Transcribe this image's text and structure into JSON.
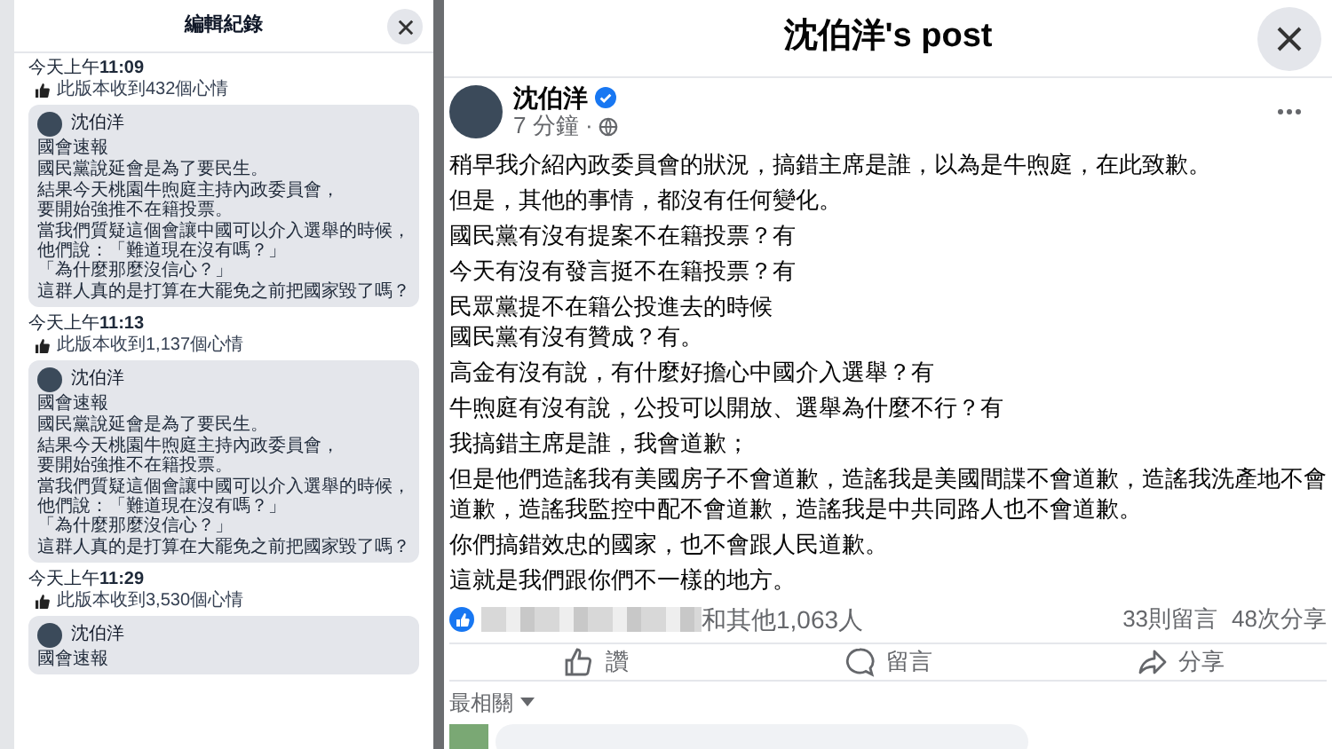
{
  "edit_history": {
    "title": "編輯紀錄",
    "versions": [
      {
        "time": "今天上午**11:09**",
        "likes": "此版本收到432個心情",
        "author": "沈伯洋",
        "paragraphs": [
          [
            "國會速報"
          ],
          [
            "國民黨說延會是為了要民生。"
          ],
          [
            "結果今天桃園牛煦庭主持內政委員會，",
            "要開始強推不在籍投票。"
          ],
          [
            "當我們質疑這個會讓中國可以介入選舉的時候，",
            "他們說：「難道現在沒有嗎？」",
            "「為什麼那麼沒信心？」"
          ],
          [
            "這群人真的是打算在大罷免之前把國家毀了嗎？"
          ]
        ]
      },
      {
        "time": "今天上午**11:13**",
        "likes": "此版本收到1,137個心情",
        "author": "沈伯洋",
        "paragraphs": [
          [
            "國會速報"
          ],
          [
            "國民黨說延會是為了要民生。"
          ],
          [
            "結果今天桃園牛煦庭主持內政委員會，",
            "要開始強推不在籍投票。"
          ],
          [
            "當我們質疑這個會讓中國可以介入選舉的時候，",
            "他們說：「難道現在沒有嗎？」",
            "「為什麼那麼沒信心？」"
          ],
          [
            "這群人真的是打算在大罷免之前把國家毀了嗎？"
          ]
        ]
      },
      {
        "time": "今天上午**11:29**",
        "likes": "此版本收到3,530個心情",
        "author": "沈伯洋",
        "paragraphs": [
          [
            "國會速報"
          ]
        ]
      }
    ]
  },
  "post": {
    "title": "沈伯洋's post",
    "author": "沈伯洋",
    "verified": true,
    "time": "7 分鐘 ·",
    "paragraphs": [
      [
        "稍早我介紹內政委員會的狀況，搞錯主席是誰，以為是牛煦庭，在此致歉。"
      ],
      [
        "但是，其他的事情，都沒有任何變化。"
      ],
      [
        "國民黨有沒有提案不在籍投票？有"
      ],
      [
        "今天有沒有發言挺不在籍投票？有"
      ],
      [
        "民眾黨提不在籍公投進去的時候",
        "國民黨有沒有贊成？有。"
      ],
      [
        "高金有沒有說，有什麼好擔心中國介入選舉？有"
      ],
      [
        "牛煦庭有沒有說，公投可以開放、選舉為什麼不行？有"
      ],
      [
        "我搞錯主席是誰，我會道歉；"
      ],
      [
        "但是他們造謠我有美國房子不會道歉，造謠我是美國間諜不會道歉，造謠我洗產地不會道歉，造謠我監控中配不會道歉，造謠我是中共同路人也不會道歉。"
      ],
      [
        "你們搞錯效忠的國家，也不會跟人民道歉。"
      ],
      [
        "這就是我們跟你們不一樣的地方。"
      ]
    ],
    "reactions": "和其他1,063人",
    "comments": "33則留言",
    "shares": "48次分享",
    "actions": [
      {
        "kind": "like",
        "label": "讚"
      },
      {
        "kind": "comment",
        "label": "留言"
      },
      {
        "kind": "share",
        "label": "分享"
      }
    ],
    "sort": "最相關"
  }
}
